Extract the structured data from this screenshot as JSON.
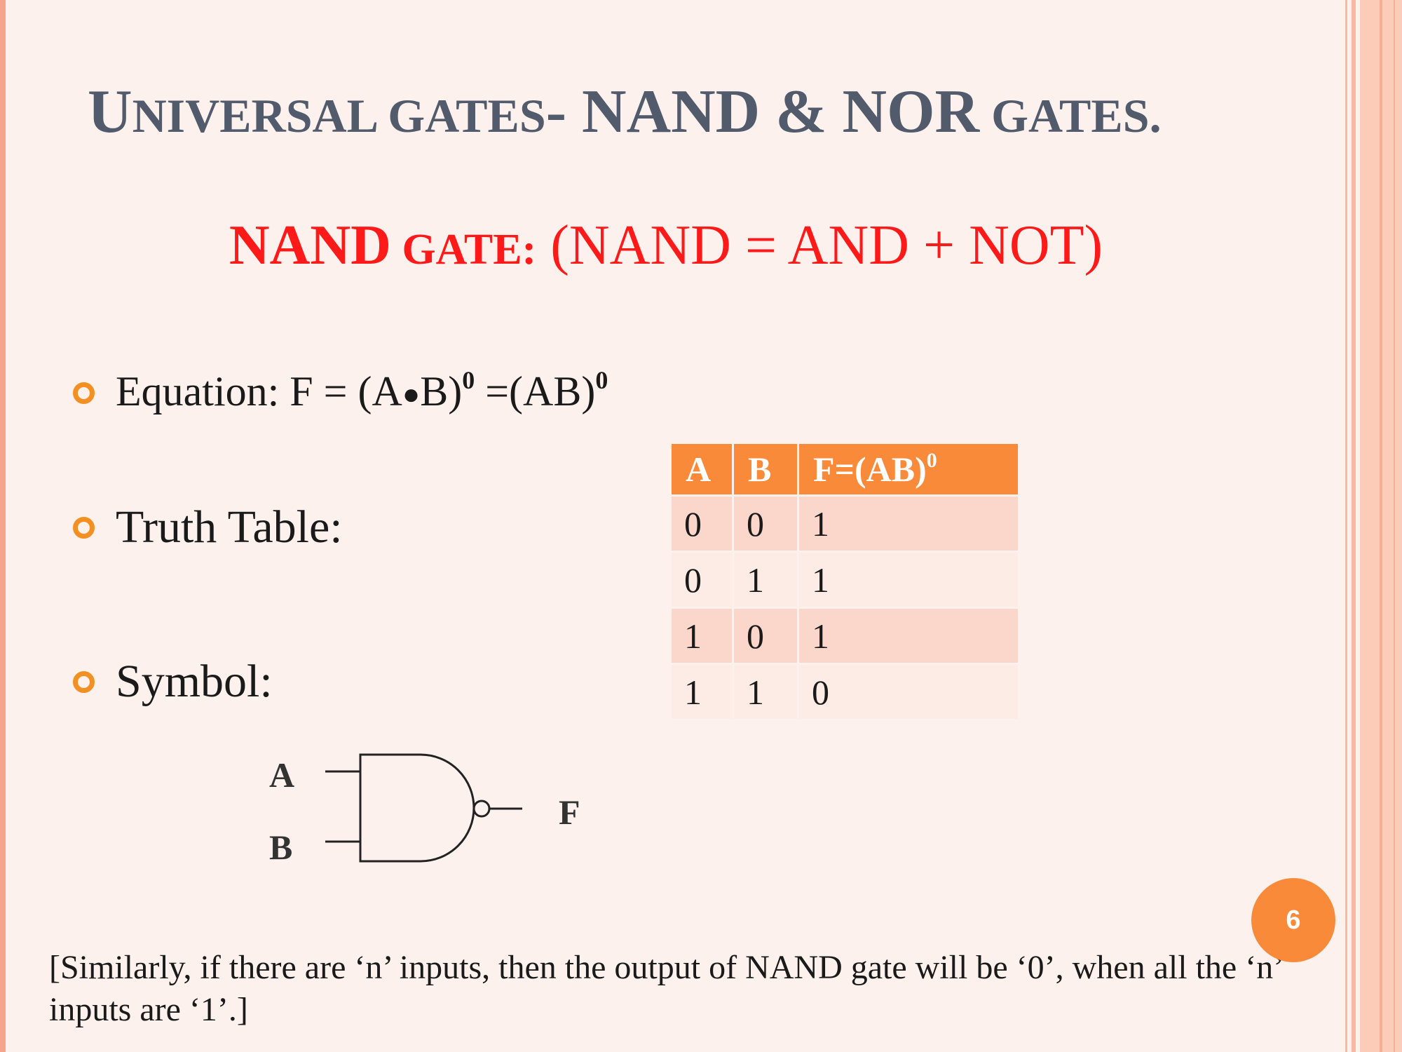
{
  "slide": {
    "title": {
      "part1_cap": "U",
      "part1_sc": "NIVERSAL GATES",
      "part2": "- NAND & NOR",
      "part3_sc": " GATES."
    },
    "subtitle": {
      "strong": "NAND",
      "sc": " GATE:",
      "rest": " (NAND = AND + NOT)"
    },
    "bullets": {
      "equation": {
        "text1": "Equation: F = (A",
        "dot": "●",
        "text2": "B)",
        "sup1": "0",
        "text3": " =(AB)",
        "sup2": "0"
      },
      "truth_table_label": "Truth Table:",
      "symbol_label": "Symbol:"
    },
    "truth_table": {
      "headers": [
        "A",
        "B",
        "F=(AB)"
      ],
      "header_sup": "0",
      "rows": [
        [
          "0",
          "0",
          "1"
        ],
        [
          "0",
          "1",
          "1"
        ],
        [
          "1",
          "0",
          "1"
        ],
        [
          "1",
          "1",
          "0"
        ]
      ]
    },
    "gate_symbol": {
      "input_a": "A",
      "input_b": "B",
      "output": "F"
    },
    "footnote": "[Similarly, if there are ‘n’ inputs, then the output of NAND gate will be ‘0’, when all the ‘n’ inputs are ‘1’.]",
    "page_number": "6",
    "colors": {
      "accent": "#f88a3a",
      "title": "#525b6c",
      "subtitle": "#ff1a1a",
      "background": "#fdf1ed"
    }
  }
}
